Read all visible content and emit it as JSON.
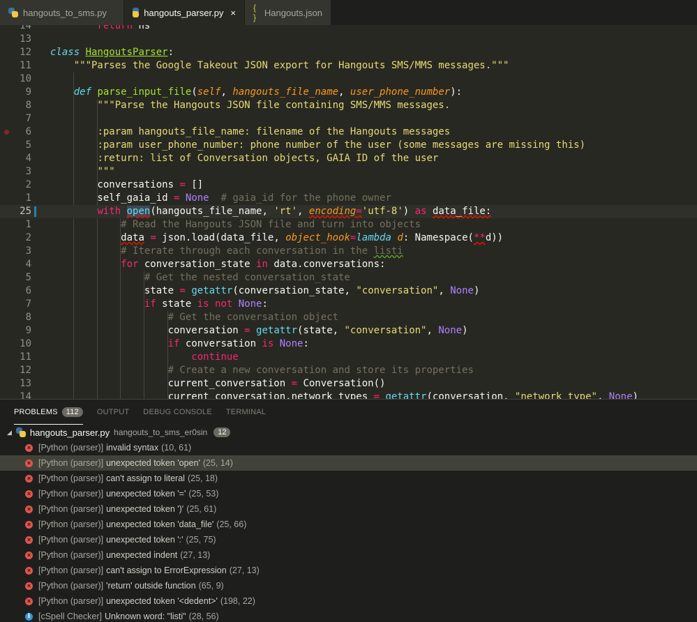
{
  "tabs": [
    {
      "label": "hangouts_to_sms.py",
      "icon": "python-icon",
      "active": false
    },
    {
      "label": "hangouts_parser.py",
      "icon": "python-icon",
      "active": true,
      "close": "×"
    },
    {
      "label": "Hangouts.json",
      "icon": "json-braces-icon",
      "active": false,
      "icon_glyph": "{ }"
    }
  ],
  "editor": {
    "lines": [
      {
        "num": "14",
        "tokens": [
          [
            "",
            "        "
          ],
          [
            "kw",
            "return"
          ],
          [
            "",
            " ns"
          ]
        ]
      },
      {
        "num": "13",
        "tokens": []
      },
      {
        "num": "12",
        "tokens": [
          [
            "st",
            "class"
          ],
          [
            "",
            " "
          ],
          [
            "cls",
            "HangoutsParser"
          ],
          [
            "",
            ":"
          ]
        ]
      },
      {
        "num": "11",
        "tokens": [
          [
            "",
            "    "
          ],
          [
            "str",
            "\"\"\"Parses the Google Takeout JSON export for Hangouts SMS/MMS messages.\"\"\""
          ]
        ]
      },
      {
        "num": "10",
        "tokens": []
      },
      {
        "num": "9",
        "tokens": [
          [
            "",
            "    "
          ],
          [
            "st",
            "def"
          ],
          [
            "",
            " "
          ],
          [
            "fn",
            "parse_input_file"
          ],
          [
            "",
            "("
          ],
          [
            "pm",
            "self"
          ],
          [
            "",
            ", "
          ],
          [
            "pm",
            "hangouts_file_name"
          ],
          [
            "",
            ", "
          ],
          [
            "pm",
            "user_phone_number"
          ],
          [
            "",
            "):"
          ]
        ]
      },
      {
        "num": "8",
        "tokens": [
          [
            "",
            "        "
          ],
          [
            "str",
            "\"\"\"Parse the Hangouts JSON file containing SMS/MMS messages."
          ]
        ]
      },
      {
        "num": "7",
        "tokens": []
      },
      {
        "num": "6",
        "breakpoint": true,
        "tokens": [
          [
            "",
            "        "
          ],
          [
            "str",
            ":param hangouts_file_name: filename of the Hangouts messages"
          ]
        ]
      },
      {
        "num": "5",
        "tokens": [
          [
            "",
            "        "
          ],
          [
            "str",
            ":param user_phone_number: phone number of the user (some messages are missing this)"
          ]
        ]
      },
      {
        "num": "4",
        "tokens": [
          [
            "",
            "        "
          ],
          [
            "str",
            ":return: list of Conversation objects, GAIA ID of the user"
          ]
        ]
      },
      {
        "num": "3",
        "tokens": [
          [
            "",
            "        "
          ],
          [
            "str",
            "\"\"\""
          ]
        ]
      },
      {
        "num": "2",
        "tokens": [
          [
            "",
            "        conversations "
          ],
          [
            "op",
            "="
          ],
          [
            "",
            " []"
          ]
        ]
      },
      {
        "num": "1",
        "tokens": [
          [
            "",
            "        self_gaia_id "
          ],
          [
            "op",
            "="
          ],
          [
            "",
            " "
          ],
          [
            "cn",
            "None"
          ],
          [
            "",
            "  "
          ],
          [
            "cm",
            "# gaia_id for the phone owner"
          ]
        ]
      },
      {
        "num": "25",
        "current": true,
        "tokens": [
          [
            "",
            "        "
          ],
          [
            "kw",
            "with"
          ],
          [
            "",
            " "
          ],
          [
            "bi-sq-hl",
            "open"
          ],
          [
            "",
            "(hangouts_file_name, "
          ],
          [
            "str",
            "'rt'"
          ],
          [
            "",
            ", "
          ],
          [
            "pm-sq",
            "encoding"
          ],
          [
            "op-sq",
            "="
          ],
          [
            "str",
            "'utf-8'"
          ],
          [
            "",
            ") "
          ],
          [
            "kw",
            "as"
          ],
          [
            "",
            " "
          ],
          [
            "sq",
            "data_file:"
          ]
        ]
      },
      {
        "num": "1",
        "tokens": [
          [
            "",
            "            "
          ],
          [
            "cm",
            "# Read the Hangouts JSON file and turn into objects"
          ]
        ]
      },
      {
        "num": "2",
        "tokens": [
          [
            "",
            "            "
          ],
          [
            "sq",
            "data"
          ],
          [
            "",
            " "
          ],
          [
            "op",
            "="
          ],
          [
            "",
            " json.load(data_file, "
          ],
          [
            "pm",
            "object_hook"
          ],
          [
            "op",
            "="
          ],
          [
            "st",
            "lambda"
          ],
          [
            "",
            " "
          ],
          [
            "pm",
            "d"
          ],
          [
            "",
            ": Namespace("
          ],
          [
            "op-sq",
            "**"
          ],
          [
            "",
            "d))"
          ]
        ]
      },
      {
        "num": "3",
        "tokens": [
          [
            "",
            "            "
          ],
          [
            "cm",
            "# Iterate through each conversation in the "
          ],
          [
            "cm-sqg",
            "listi"
          ]
        ]
      },
      {
        "num": "4",
        "tokens": [
          [
            "",
            "            "
          ],
          [
            "kw",
            "for"
          ],
          [
            "",
            " conversation_state "
          ],
          [
            "kw",
            "in"
          ],
          [
            "",
            " data.conversations:"
          ]
        ]
      },
      {
        "num": "5",
        "tokens": [
          [
            "",
            "                "
          ],
          [
            "cm",
            "# Get the nested conversation_state"
          ]
        ]
      },
      {
        "num": "6",
        "tokens": [
          [
            "",
            "                state "
          ],
          [
            "op",
            "="
          ],
          [
            "",
            " "
          ],
          [
            "bi",
            "getattr"
          ],
          [
            "",
            "(conversation_state, "
          ],
          [
            "str",
            "\"conversation\""
          ],
          [
            "",
            ", "
          ],
          [
            "cn",
            "None"
          ],
          [
            "",
            ")"
          ]
        ]
      },
      {
        "num": "7",
        "tokens": [
          [
            "",
            "                "
          ],
          [
            "kw",
            "if"
          ],
          [
            "",
            " state "
          ],
          [
            "kw",
            "is not"
          ],
          [
            "",
            " "
          ],
          [
            "cn",
            "None"
          ],
          [
            "",
            ":"
          ]
        ]
      },
      {
        "num": "8",
        "tokens": [
          [
            "",
            "                    "
          ],
          [
            "cm",
            "# Get the conversation object"
          ]
        ]
      },
      {
        "num": "9",
        "tokens": [
          [
            "",
            "                    conversation "
          ],
          [
            "op",
            "="
          ],
          [
            "",
            " "
          ],
          [
            "bi",
            "getattr"
          ],
          [
            "",
            "(state, "
          ],
          [
            "str",
            "\"conversation\""
          ],
          [
            "",
            ", "
          ],
          [
            "cn",
            "None"
          ],
          [
            "",
            ")"
          ]
        ]
      },
      {
        "num": "10",
        "tokens": [
          [
            "",
            "                    "
          ],
          [
            "kw",
            "if"
          ],
          [
            "",
            " conversation "
          ],
          [
            "kw",
            "is"
          ],
          [
            "",
            " "
          ],
          [
            "cn",
            "None"
          ],
          [
            "",
            ":"
          ]
        ]
      },
      {
        "num": "11",
        "tokens": [
          [
            "",
            "                        "
          ],
          [
            "kw",
            "continue"
          ]
        ]
      },
      {
        "num": "12",
        "tokens": [
          [
            "",
            "                    "
          ],
          [
            "cm",
            "# Create a new conversation and store its properties"
          ]
        ]
      },
      {
        "num": "13",
        "tokens": [
          [
            "",
            "                    current_conversation "
          ],
          [
            "op",
            "="
          ],
          [
            "",
            " Conversation()"
          ]
        ]
      },
      {
        "num": "14",
        "tokens": [
          [
            "",
            "                    current_conversation.network_types "
          ],
          [
            "op",
            "="
          ],
          [
            "",
            " "
          ],
          [
            "bi",
            "getattr"
          ],
          [
            "",
            "(conversation, "
          ],
          [
            "str",
            "\"network_type\""
          ],
          [
            "",
            ", "
          ],
          [
            "cn",
            "None"
          ],
          [
            "",
            ")"
          ]
        ]
      }
    ]
  },
  "panel": {
    "tabs": [
      {
        "label": "PROBLEMS",
        "badge": "112",
        "active": true
      },
      {
        "label": "OUTPUT",
        "active": false
      },
      {
        "label": "DEBUG CONSOLE",
        "active": false
      },
      {
        "label": "TERMINAL",
        "active": false
      }
    ],
    "group": {
      "file": "hangouts_parser.py",
      "path": "hangouts_to_sms_er0sin",
      "count": "12"
    },
    "problems": [
      {
        "severity": "error",
        "source": "[Python (parser)]",
        "message": "invalid syntax",
        "pos": "(10, 61)"
      },
      {
        "severity": "error",
        "source": "[Python (parser)]",
        "message": "unexpected token 'open'",
        "pos": "(25, 14)",
        "selected": true
      },
      {
        "severity": "error",
        "source": "[Python (parser)]",
        "message": "can't assign to literal",
        "pos": "(25, 18)"
      },
      {
        "severity": "error",
        "source": "[Python (parser)]",
        "message": "unexpected token '='",
        "pos": "(25, 53)"
      },
      {
        "severity": "error",
        "source": "[Python (parser)]",
        "message": "unexpected token ')'",
        "pos": "(25, 61)"
      },
      {
        "severity": "error",
        "source": "[Python (parser)]",
        "message": "unexpected token 'data_file'",
        "pos": "(25, 66)"
      },
      {
        "severity": "error",
        "source": "[Python (parser)]",
        "message": "unexpected token ':'",
        "pos": "(25, 75)"
      },
      {
        "severity": "error",
        "source": "[Python (parser)]",
        "message": "unexpected indent",
        "pos": "(27, 13)"
      },
      {
        "severity": "error",
        "source": "[Python (parser)]",
        "message": "can't assign to ErrorExpression",
        "pos": "(27, 13)"
      },
      {
        "severity": "error",
        "source": "[Python (parser)]",
        "message": "'return' outside function",
        "pos": "(65, 9)"
      },
      {
        "severity": "error",
        "source": "[Python (parser)]",
        "message": "unexpected token '<dedent>'",
        "pos": "(198, 22)"
      },
      {
        "severity": "info",
        "source": "[cSpell Checker]",
        "message": "Unknown word: \"listi\"",
        "pos": "(28, 56)"
      }
    ]
  },
  "colors": {
    "background": "#272822",
    "keyword": "#f92672",
    "function": "#a6e22e",
    "string": "#e6db74",
    "comment": "#75715e",
    "param": "#fd971f",
    "builtin": "#66d9ef",
    "constant": "#ae81ff",
    "error": "#e5534b",
    "info": "#3a96dd"
  }
}
